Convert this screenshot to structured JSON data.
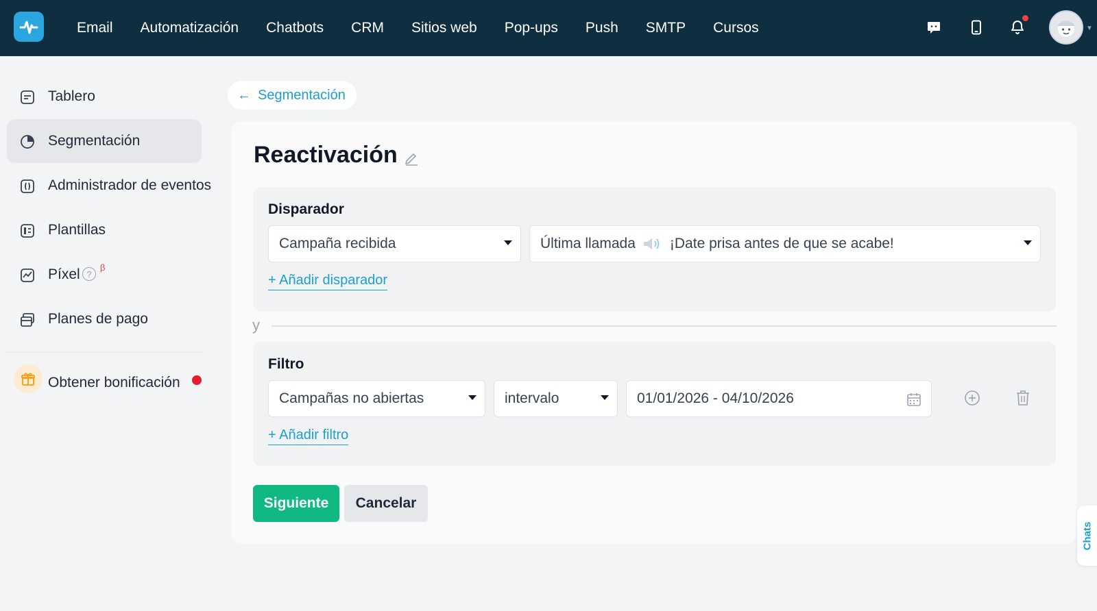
{
  "nav": {
    "items": [
      "Email",
      "Automatización",
      "Chatbots",
      "CRM",
      "Sitios web",
      "Pop-ups",
      "Push",
      "SMTP",
      "Cursos"
    ],
    "icons": [
      "chat-support-icon",
      "mobile-icon",
      "bell-icon",
      "avatar"
    ]
  },
  "sidebar": {
    "items": [
      {
        "label": "Tablero",
        "icon": "dashboard-icon"
      },
      {
        "label": "Segmentación",
        "icon": "pie-chart-icon",
        "active": true
      },
      {
        "label": "Administrador de eventos",
        "icon": "events-icon"
      },
      {
        "label": "Plantillas",
        "icon": "templates-icon"
      },
      {
        "label": "Píxel",
        "icon": "pixel-icon",
        "badge": "β",
        "help": "?"
      },
      {
        "label": "Planes de pago",
        "icon": "payment-plans-icon"
      }
    ],
    "bonus": {
      "label": "Obtener bonificación",
      "icon": "gift-icon"
    }
  },
  "breadcrumb": {
    "back_arrow": "←",
    "label": "Segmentación"
  },
  "page": {
    "title": "Reactivación"
  },
  "trigger": {
    "title": "Disparador",
    "select1": "Campaña recibida",
    "select2_prefix": "Última llamada",
    "select2_suffix": "¡Date prisa antes de que se acabe!",
    "add_label": "+ Añadir disparador"
  },
  "joiner": "y",
  "filter": {
    "title": "Filtro",
    "select1": "Campañas no abiertas",
    "select2": "intervalo",
    "date_range": "01/01/2026 - 04/10/2026",
    "add_label": "+ Añadir filtro"
  },
  "buttons": {
    "next": "Siguiente",
    "cancel": "Cancelar"
  },
  "chats_tab": "Chats",
  "colors": {
    "accent": "#1a9fd0",
    "primary": "#10b981",
    "topbar": "#0f2e40"
  }
}
